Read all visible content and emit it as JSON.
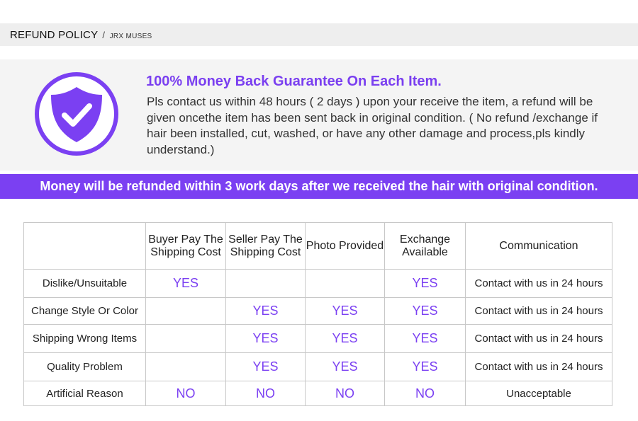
{
  "header": {
    "title": "REFUND POLICY",
    "separator": "/",
    "subtitle": "JRX MUSES"
  },
  "guarantee": {
    "icon": "shield-check-icon",
    "title": "100% Money Back Guarantee On Each Item.",
    "body": "Pls contact us within 48 hours ( 2 days ) upon your receive the item, a refund will be given oncethe item has been sent back in original condition. ( No refund /exchange if hair been installed, cut, washed, or have any other damage and process,pls kindly understand.)"
  },
  "banner": {
    "text": "Money will be refunded within 3 work days after we received the hair with original condition."
  },
  "table": {
    "headers": [
      "",
      "Buyer Pay The Shipping Cost",
      "Seller Pay The Shipping Cost",
      "Photo Provided",
      "Exchange Available",
      "Communication"
    ],
    "rows": [
      {
        "label": "Dislike/Unsuitable",
        "cells": [
          "YES",
          "",
          "",
          "YES"
        ],
        "communication": "Contact with us in 24 hours"
      },
      {
        "label": "Change Style Or Color",
        "cells": [
          "",
          "YES",
          "YES",
          "YES"
        ],
        "communication": "Contact with us in 24 hours"
      },
      {
        "label": "Shipping Wrong Items",
        "cells": [
          "",
          "YES",
          "YES",
          "YES"
        ],
        "communication": "Contact with us in 24 hours"
      },
      {
        "label": "Quality Problem",
        "cells": [
          "",
          "YES",
          "YES",
          "YES"
        ],
        "communication": "Contact with us in 24 hours"
      },
      {
        "label": "Artificial Reason",
        "cells": [
          "NO",
          "NO",
          "NO",
          "NO"
        ],
        "communication": "Unacceptable"
      }
    ]
  },
  "colors": {
    "accent": "#7b40f2",
    "title": "#7a3ff0"
  }
}
